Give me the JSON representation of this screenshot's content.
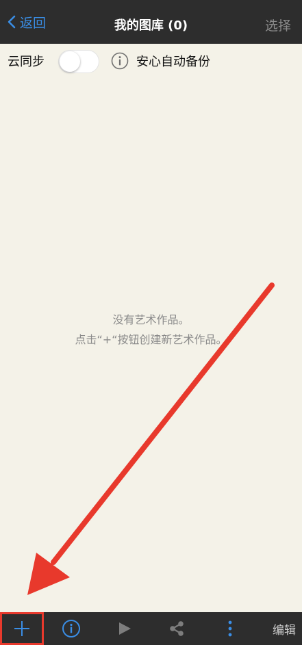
{
  "navbar": {
    "back_label": "返回",
    "title": "我的图库 (0)",
    "select_label": "选择"
  },
  "sync_row": {
    "sync_label": "云同步",
    "toggle_state": "off",
    "backup_label": "安心自动备份"
  },
  "empty_state": {
    "line1": "没有艺术作品。",
    "line2": "点击“+“按钮创建新艺术作品。"
  },
  "toolbar": {
    "add_icon": "plus-icon",
    "info_icon": "info-icon",
    "play_icon": "play-icon",
    "share_icon": "share-icon",
    "more_icon": "more-vertical-icon",
    "edit_label": "编辑"
  },
  "colors": {
    "bar_background": "#2d2d2d",
    "accent": "#3a8ee6",
    "page_background": "#f4f2e8",
    "annotation_red": "#e8392c"
  }
}
